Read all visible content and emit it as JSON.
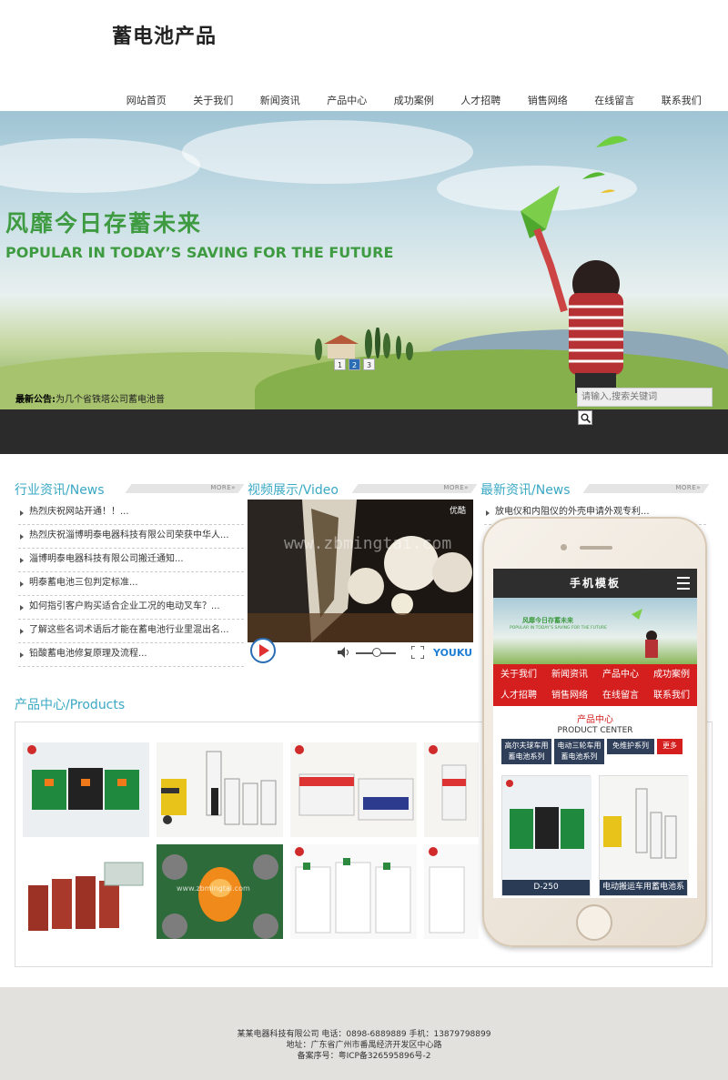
{
  "site": {
    "logo": "蓄电池产品"
  },
  "nav": [
    "网站首页",
    "关于我们",
    "新闻资讯",
    "产品中心",
    "成功案例",
    "人才招聘",
    "销售网络",
    "在线留言",
    "联系我们"
  ],
  "banner": {
    "title_cn": "风靡今日存蓄未来",
    "title_en": "POPULAR IN TODAY’S SAVING FOR THE FUTURE",
    "slides": [
      "1",
      "2",
      "3"
    ],
    "active_slide": 2
  },
  "notice": {
    "label": "最新公告:",
    "text": "为几个省铁塔公司蓄电池普"
  },
  "search": {
    "placeholder": "请输入,搜索关键词"
  },
  "sections": {
    "industry": {
      "title": "行业资讯/News",
      "more": "MORE»"
    },
    "video": {
      "title": "视频展示/Video",
      "more": "MORE»"
    },
    "latest": {
      "title": "最新资讯/News",
      "more": "MORE»"
    },
    "products": {
      "title": "产品中心/Products"
    }
  },
  "industry_news": [
    "热烈庆祝网站开通！！...",
    "热烈庆祝淄博明泰电器科技有限公司荣获中华人...",
    "淄博明泰电器科技有限公司搬迁通知...",
    "明泰蓄电池三包判定标准...",
    "如何指引客户购买适合企业工况的电动叉车？...",
    "了解这些名词术语后才能在蓄电池行业里混出名...",
    "铅酸蓄电池修复原理及流程..."
  ],
  "latest_news": [
    "放电仪和内阻仪的外壳申请外观专利..."
  ],
  "video": {
    "watermark": "www.zbmingtai.com",
    "player_brand": "YOUKU",
    "badge": "优酷"
  },
  "product_watermark": "www.zbmingtai.com",
  "mobile": {
    "header": "手机模板",
    "banner_cn": "风靡今日存蓄未来",
    "banner_en": "POPULAR IN TODAY’S SAVING FOR THE FUTURE",
    "nav": [
      "关于我们",
      "新闻资讯",
      "产品中心",
      "成功案例",
      "人才招聘",
      "销售网络",
      "在线留言",
      "联系我们"
    ],
    "pc_title": "产品中心",
    "pc_sub": "PRODUCT CENTER",
    "cats": [
      "高尔夫球车用蓄电池系列",
      "电动三轮车用蓄电池系列",
      "免维护系列",
      "更多"
    ],
    "products": [
      "D-250",
      "电动搬运车用蓄电池系"
    ]
  },
  "footer": {
    "line1": "某某电器科技有限公司    电话：0898-6889889  手机：13879798899",
    "line2": "地址：广东省广州市番禺经济开发区中心路",
    "line3": "备案序号：粤ICP备326595896号-2"
  },
  "colors": {
    "accent_blue": "#3aa8c4",
    "banner_green": "#3f9b41",
    "mobile_red": "#d51f1f",
    "dark": "#2b2b2b"
  }
}
